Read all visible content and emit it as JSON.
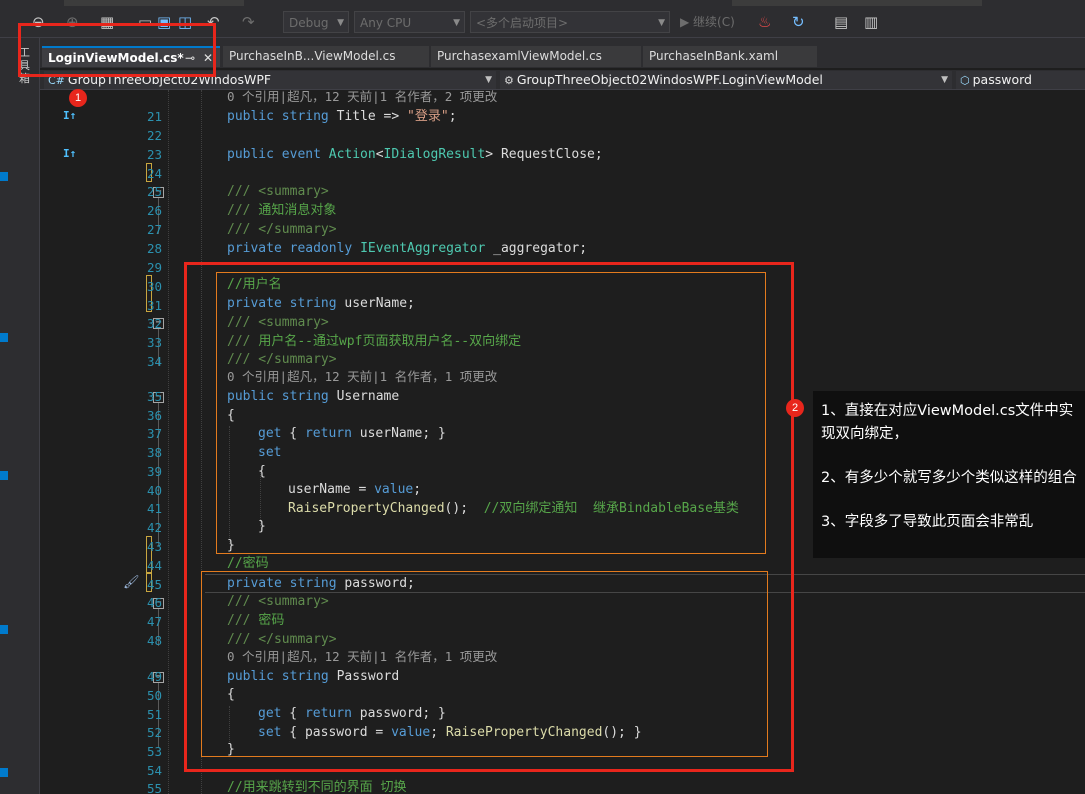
{
  "toolbar": {
    "config": "Debug",
    "platform": "Any CPU",
    "startup": "<多个启动项目>",
    "continue_label": "继续(C)"
  },
  "side_panel": {
    "label": "工具箱"
  },
  "tabs": [
    {
      "label": "LoginViewModel.cs*",
      "active": true
    },
    {
      "label": "PurchaseInB...ViewModel.cs",
      "active": false
    },
    {
      "label": "PurchasexamlViewModel.cs",
      "active": false
    },
    {
      "label": "PurchaseInBank.xaml",
      "active": false
    }
  ],
  "nav": {
    "project": "GroupThreeObject02WindosWPF",
    "class": "GroupThreeObject02WindosWPF.LoginViewModel",
    "member": "password"
  },
  "lines": {
    "lens_top": "0 个引用|超凡，12 天前|1 名作者，2 项更改",
    "l21": {
      "n": "21",
      "kw": "public",
      "t": "string",
      "rest": " Title => ",
      "str": "\"登录\"",
      "end": ";"
    },
    "l22": {
      "n": "22"
    },
    "l23": {
      "n": "23",
      "kw": "public event",
      "t": "Action",
      "rest": "<",
      "t2": "IDialogResult",
      "end": "> RequestClose;"
    },
    "l24": {
      "n": "24"
    },
    "l25": {
      "n": "25",
      "dx": "/// <summary>"
    },
    "l26": {
      "n": "26",
      "dx": "/// ",
      "cm": "通知消息对象"
    },
    "l27": {
      "n": "27",
      "dx": "/// </summary>"
    },
    "l28": {
      "n": "28",
      "kw": "private readonly",
      "t": "IEventAggregator",
      "rest": " _aggregator;"
    },
    "l29": {
      "n": "29"
    },
    "l30": {
      "n": "30",
      "cm": "//用户名"
    },
    "l31": {
      "n": "31",
      "kw": "private string",
      "rest": " userName;"
    },
    "l32": {
      "n": "32",
      "dx": "/// <summary>"
    },
    "l33": {
      "n": "33",
      "dx": "/// ",
      "cm": "用户名--通过wpf页面获取用户名--双向绑定"
    },
    "l34": {
      "n": "34",
      "dx": "/// </summary>"
    },
    "lens_username": "0 个引用|超凡，12 天前|1 名作者，1 项更改",
    "l35": {
      "n": "35",
      "kw": "public string",
      "rest": " Username"
    },
    "l36": {
      "n": "36",
      "rest": "{"
    },
    "l37": {
      "n": "37",
      "kw": "get",
      "rest": " { ",
      "kw2": "return",
      "end": " userName; }"
    },
    "l38": {
      "n": "38",
      "kw": "set"
    },
    "l39": {
      "n": "39",
      "rest": "{"
    },
    "l40": {
      "n": "40",
      "rest": "userName = ",
      "kw": "value",
      "end": ";"
    },
    "l41": {
      "n": "41",
      "fn": "RaisePropertyChanged",
      "rest": "();  ",
      "cm": "//双向绑定通知  继承BindableBase基类"
    },
    "l42": {
      "n": "42",
      "rest": "}"
    },
    "l43": {
      "n": "43",
      "rest": "}"
    },
    "l44": {
      "n": "44",
      "cm": "//密码"
    },
    "l45": {
      "n": "45",
      "kw": "private string",
      "rest": " password;"
    },
    "l46": {
      "n": "46",
      "dx": "/// <summary>"
    },
    "l47": {
      "n": "47",
      "dx": "/// ",
      "cm": "密码"
    },
    "l48": {
      "n": "48",
      "dx": "/// </summary>"
    },
    "lens_password": "0 个引用|超凡，12 天前|1 名作者，1 项更改",
    "l49": {
      "n": "49",
      "kw": "public string",
      "rest": " Password"
    },
    "l50": {
      "n": "50",
      "rest": "{"
    },
    "l51": {
      "n": "51",
      "kw": "get",
      "rest": " { ",
      "kw2": "return",
      "end": " password; }"
    },
    "l52": {
      "n": "52",
      "kw": "set",
      "rest": " { password = ",
      "kw2": "value",
      "mid": "; ",
      "fn": "RaisePropertyChanged",
      "end": "(); }"
    },
    "l53": {
      "n": "53",
      "rest": "}"
    },
    "l54": {
      "n": "54"
    },
    "l55": {
      "n": "55",
      "cm": "//用来跳转到不同的界面 切换"
    }
  },
  "annotations": {
    "badge1": "1",
    "badge2": "2",
    "note1": "1、直接在对应ViewModel.cs文件中实现双向绑定，",
    "note2": "2、有多少个就写多少个类似这样的组合",
    "note3": "3、字段多了导致此页面会非常乱",
    "colors": {
      "red": "#e8261c",
      "orange": "#e37b1e"
    }
  }
}
